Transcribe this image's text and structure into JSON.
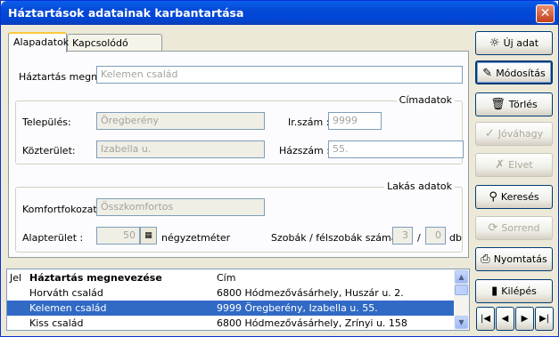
{
  "window": {
    "title": "Háztartások adatainak karbantartása",
    "close_glyph": "✕"
  },
  "tabs": [
    {
      "label": "Alapadatok"
    },
    {
      "label": "Kapcsolódó adatok"
    }
  ],
  "form": {
    "household_name": {
      "label": "Háztartás megn.:",
      "value": "Kelemen család"
    },
    "address_group": {
      "title": "Címadatok"
    },
    "settlement": {
      "label": "Település:",
      "value": "Öregberény"
    },
    "zip": {
      "label": "Ir.szám :",
      "value": "9999"
    },
    "street": {
      "label": "Közterület:",
      "value": "Izabella u."
    },
    "house_number": {
      "label": "Házszám :",
      "value": "55."
    },
    "dwelling_group": {
      "title": "Lakás adatok"
    },
    "comfort": {
      "label": "Komfortfokozat :",
      "value": "Összkomfortos"
    },
    "area": {
      "label": "Alapterület :",
      "value": "50",
      "unit": "négyzetméter"
    },
    "rooms": {
      "label": "Szobák / félszobák száma :",
      "rooms": "3",
      "sep": "/",
      "half_rooms": "0",
      "unit": "db"
    }
  },
  "buttons": {
    "new": "Új adat",
    "modify": "Módosítás",
    "delete": "Törlés",
    "approve": "Jóváhagy",
    "discard": "Elvet",
    "search": "Keresés",
    "sort": "Sorrend",
    "print": "Nyomtatás",
    "exit": "Kilépés"
  },
  "nav": {
    "first": "|◀",
    "prev": "◀",
    "next": "▶",
    "last": "▶|"
  },
  "grid": {
    "headers": {
      "mark": "Jel",
      "name": "Háztartás megnevezése",
      "address": "Cím"
    },
    "rows": [
      {
        "name": "Horváth család",
        "address": "6800 Hódmezővásárhely, Huszár u. 2."
      },
      {
        "name": "Kelemen család",
        "address": "9999 Öregberény, Izabella u. 55.",
        "selected": true
      },
      {
        "name": "Kiss család",
        "address": "6800 Hódmezővásárhely, Zrínyi u. 158"
      }
    ]
  },
  "colors": {
    "titlebar": "#0A5FEA",
    "selection": "#316AC5",
    "face": "#ECE9D8"
  }
}
